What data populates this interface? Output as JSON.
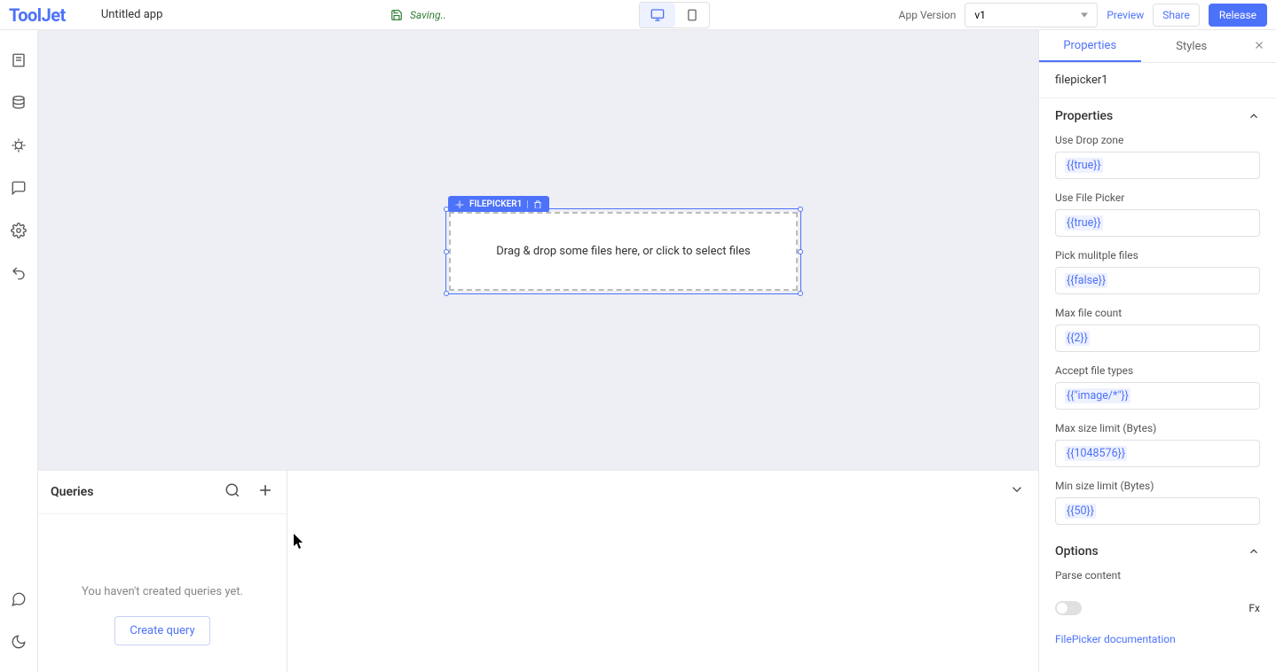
{
  "header": {
    "logo": "ToolJet",
    "app_name": "Untitled app",
    "save_status": "Saving..",
    "version_label": "App Version",
    "version_value": "v1",
    "preview": "Preview",
    "share": "Share",
    "release": "Release"
  },
  "canvas": {
    "component_badge": "FILEPICKER1",
    "filepicker_text": "Drag & drop some files here, or click to select files"
  },
  "queries": {
    "title": "Queries",
    "empty_text": "You haven't created queries yet.",
    "create_btn": "Create query"
  },
  "inspector": {
    "tab_properties": "Properties",
    "tab_styles": "Styles",
    "component_name": "filepicker1",
    "section_properties": "Properties",
    "props": {
      "use_drop_zone": {
        "label": "Use Drop zone",
        "value": "{{true}}"
      },
      "use_file_picker": {
        "label": "Use File Picker",
        "value": "{{true}}"
      },
      "pick_multiple": {
        "label": "Pick mulitple files",
        "value": "{{false}}"
      },
      "max_file_count": {
        "label": "Max file count",
        "value": "{{2}}"
      },
      "accept_types": {
        "label": "Accept file types",
        "value": "{{\"image/*\"}}"
      },
      "max_size": {
        "label": "Max size limit (Bytes)",
        "value": "{{1048576}}"
      },
      "min_size": {
        "label": "Min size limit (Bytes)",
        "value": "{{50}}"
      }
    },
    "section_options": "Options",
    "parse_content": "Parse content",
    "fx": "Fx",
    "doc_link": "FilePicker documentation"
  }
}
